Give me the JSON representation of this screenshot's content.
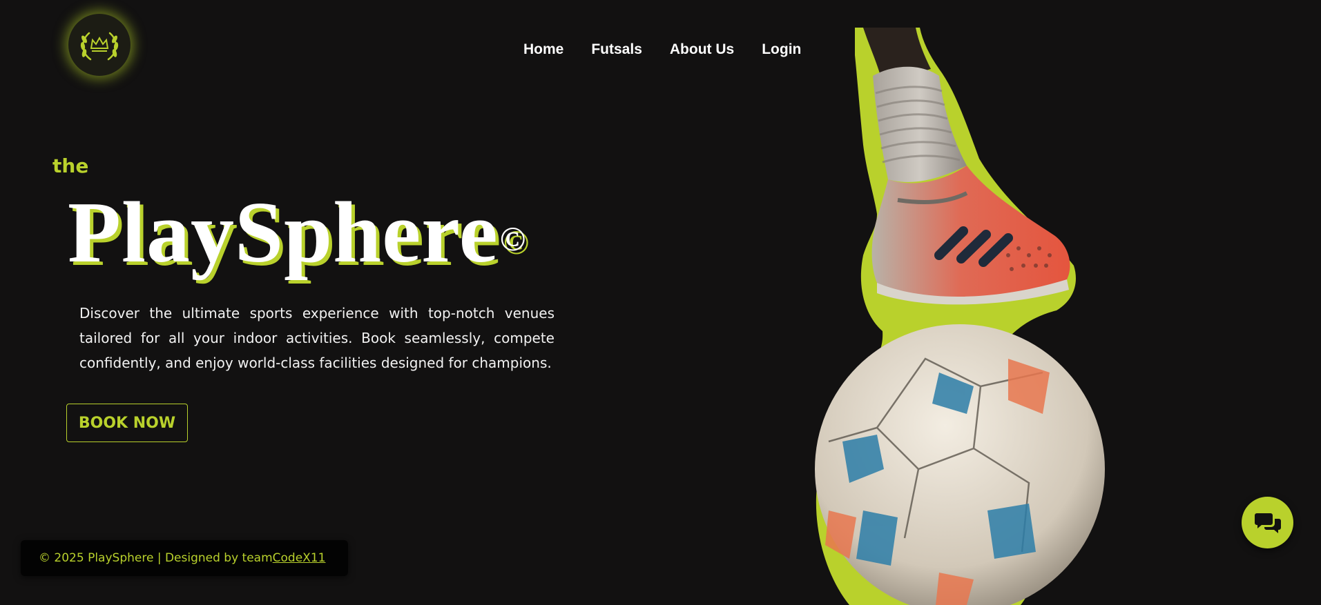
{
  "header": {
    "logo_icon": "laurel-crown-icon",
    "nav": [
      {
        "label": "Home"
      },
      {
        "label": "Futsals"
      },
      {
        "label": "About Us"
      },
      {
        "label": "Login"
      }
    ]
  },
  "hero": {
    "pre_title": "the",
    "title": "PlaySphere",
    "title_mark": "©",
    "description": "Discover the ultimate sports experience with top-notch venues tailored for all your indoor activities. Book seamlessly, compete confidently, and enjoy world-class facilities designed for champions.",
    "cta_label": "BOOK NOW",
    "image": "football-boot-on-ball-image"
  },
  "footer": {
    "text": "© 2025 PlaySphere | Designed by team ",
    "link": "CodeX11"
  },
  "chat": {
    "icon": "chat-bubbles-icon"
  },
  "colors": {
    "accent": "#b9d12c",
    "background": "#121111",
    "text": "#ffffff"
  }
}
